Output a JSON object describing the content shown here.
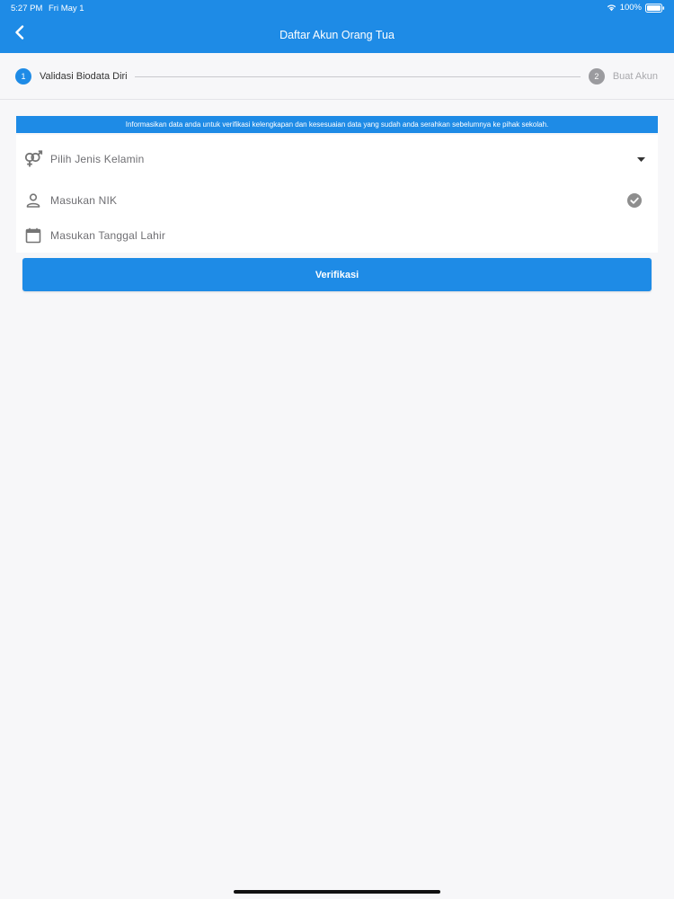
{
  "status_bar": {
    "time": "5:27 PM",
    "date": "Fri May 1",
    "battery": "100%"
  },
  "app_bar": {
    "title": "Daftar Akun Orang Tua",
    "back_icon": "chevron-left-icon"
  },
  "stepper": {
    "steps": [
      {
        "number": "1",
        "label": "Validasi Biodata Diri",
        "active": true
      },
      {
        "number": "2",
        "label": "Buat Akun",
        "active": false
      }
    ]
  },
  "info_banner": {
    "text": "Informasikan data anda untuk verifikasi kelengkapan dan kesesuaian data yang sudah anda serahkan sebelumnya ke pihak sekolah."
  },
  "form": {
    "gender": {
      "placeholder": "Pilih Jenis Kelamin",
      "icon": "gender-icon"
    },
    "nik": {
      "placeholder": "Masukan NIK",
      "icon": "person-icon"
    },
    "dob": {
      "placeholder": "Masukan Tanggal Lahir",
      "icon": "calendar-icon"
    }
  },
  "verify_button": {
    "label": "Verifikasi"
  },
  "colors": {
    "primary": "#1e8be6",
    "inactive_step": "#9b9b9f",
    "background": "#f7f7f9"
  }
}
